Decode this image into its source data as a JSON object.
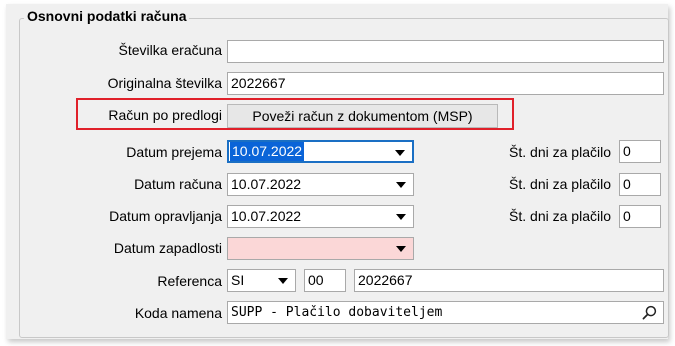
{
  "group": {
    "title": "Osnovni podatki računa"
  },
  "fields": {
    "stevilka_eracuna": {
      "label": "Številka eračuna",
      "value": ""
    },
    "originalna_stevilka": {
      "label": "Originalna številka",
      "value": "2022667"
    },
    "racun_po_predlogi": {
      "label": "Račun po predlogi",
      "button_label": "Poveži račun z dokumentom (MSP)"
    },
    "datum_prejema": {
      "label": "Datum prejema",
      "value": "10.07.2022"
    },
    "datum_racuna": {
      "label": "Datum računa",
      "value": "10.07.2022"
    },
    "datum_opravljanja": {
      "label": "Datum opravljanja",
      "value": "10.07.2022"
    },
    "datum_zapadlosti": {
      "label": "Datum zapadlosti",
      "value": ""
    },
    "st_dni_1": {
      "label": "Št. dni za plačilo",
      "value": "0"
    },
    "st_dni_2": {
      "label": "Št. dni za plačilo",
      "value": "0"
    },
    "st_dni_3": {
      "label": "Št. dni za plačilo",
      "value": "0"
    },
    "referenca": {
      "label": "Referenca",
      "model": "SI",
      "part1": "00",
      "part2": "2022667"
    },
    "koda_namena": {
      "label": "Koda namena",
      "value": "SUPP - Plačilo dobaviteljem"
    }
  },
  "colors": {
    "highlight_border": "#e0202a",
    "focus_border": "#1a6fc4",
    "error_fill": "#fbd7d7"
  },
  "icons": {
    "search": "search-icon",
    "dropdown": "chevron-down-icon"
  }
}
